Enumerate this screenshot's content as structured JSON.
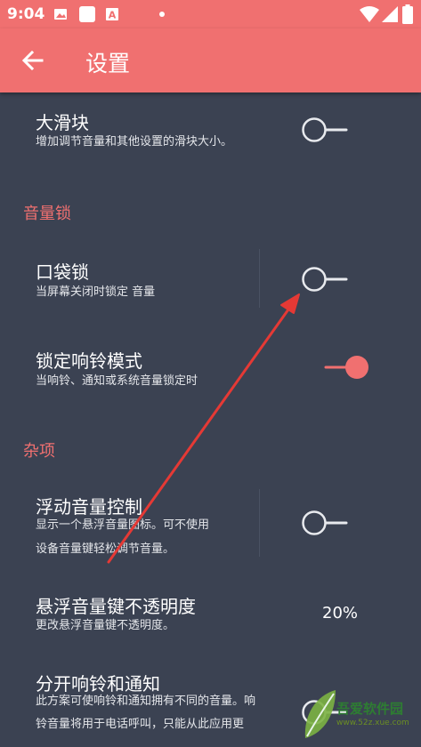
{
  "status_bar": {
    "time": "9:04",
    "icons": [
      "image-icon",
      "square-icon",
      "text-a-icon",
      "dot-icon",
      "wifi-icon",
      "signal-icon",
      "battery-icon"
    ]
  },
  "app_bar": {
    "back_icon": "arrow-left-icon",
    "title": "设置"
  },
  "settings": [
    {
      "id": "large-slider",
      "title": "大滑块",
      "summary": [
        "增加调节音量和其他设置的滑块大小。"
      ],
      "control": "switch",
      "on": false
    },
    {
      "section": "音量锁"
    },
    {
      "id": "pocket-lock",
      "title": "口袋锁",
      "summary": [
        "当屏幕关闭时锁定 音量"
      ],
      "control": "switch",
      "on": false
    },
    {
      "id": "lock-ringer-mode",
      "title": "锁定响铃模式",
      "summary": [
        "当响铃、通知或系统音量锁定时"
      ],
      "control": "switch",
      "on": true
    },
    {
      "section": "杂项"
    },
    {
      "id": "floating-volume-control",
      "title": "浮动音量控制",
      "summary": [
        "显示一个悬浮音量图标。可不使用",
        "设备音量键轻松调节音量。"
      ],
      "control": "switch",
      "on": false
    },
    {
      "id": "floating-key-opacity",
      "title": "悬浮音量键不透明度",
      "summary": [
        "更改悬浮音量键不透明度。"
      ],
      "control": "value",
      "value": "20%"
    },
    {
      "id": "split-ring-notification",
      "title": "分开响铃和通知",
      "summary": [
        "此方案可使响铃和通知拥有不同的音量。响",
        "铃音量将用于电话呼叫，只能从此应用更"
      ],
      "control": "switch",
      "on": false
    }
  ],
  "colors": {
    "accent": "#f07070",
    "background": "#3b4252",
    "switch_off": "#e8eaee",
    "arrow": "#e53935"
  },
  "watermark": {
    "title": "吾爱软件园",
    "url": "www.52z.xue.com"
  }
}
